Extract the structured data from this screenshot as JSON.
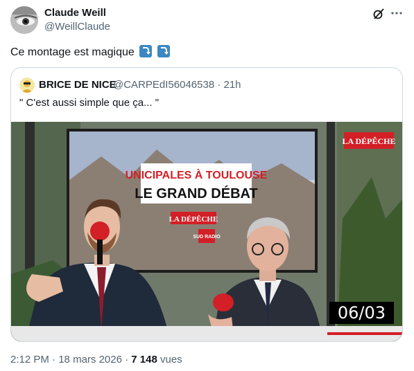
{
  "tweet": {
    "author_name": "Claude Weill",
    "author_handle": "@WeillClaude",
    "text": "Ce montage est magique",
    "emoji": [
      "arrow-curving-down",
      "arrow-curving-down"
    ],
    "time": "2:12 PM",
    "separator": "·",
    "date": "18 mars 2026",
    "views_count": "7 148",
    "views_label": "vues"
  },
  "quoted": {
    "author_name": "BRICE DE NICE",
    "author_handle": "@CARPEdI56046538",
    "separator": "·",
    "age": "21h",
    "text": "\" C'est aussi simple que ça... \""
  },
  "video": {
    "screen_title_1": "UNICIPALES À TOULOUSE",
    "screen_title_2": "LE GRAND DÉBAT",
    "logo": "LA DÉPÊCHE",
    "corner_logo": "LA DÉPÊCHE",
    "partner": "SUD RADIO",
    "timestamp": "06/03",
    "colors": {
      "red": "#d31f26",
      "accent": "#1d9bf0"
    }
  },
  "icons": {
    "grok": "grok-icon",
    "more": "more-icon"
  }
}
